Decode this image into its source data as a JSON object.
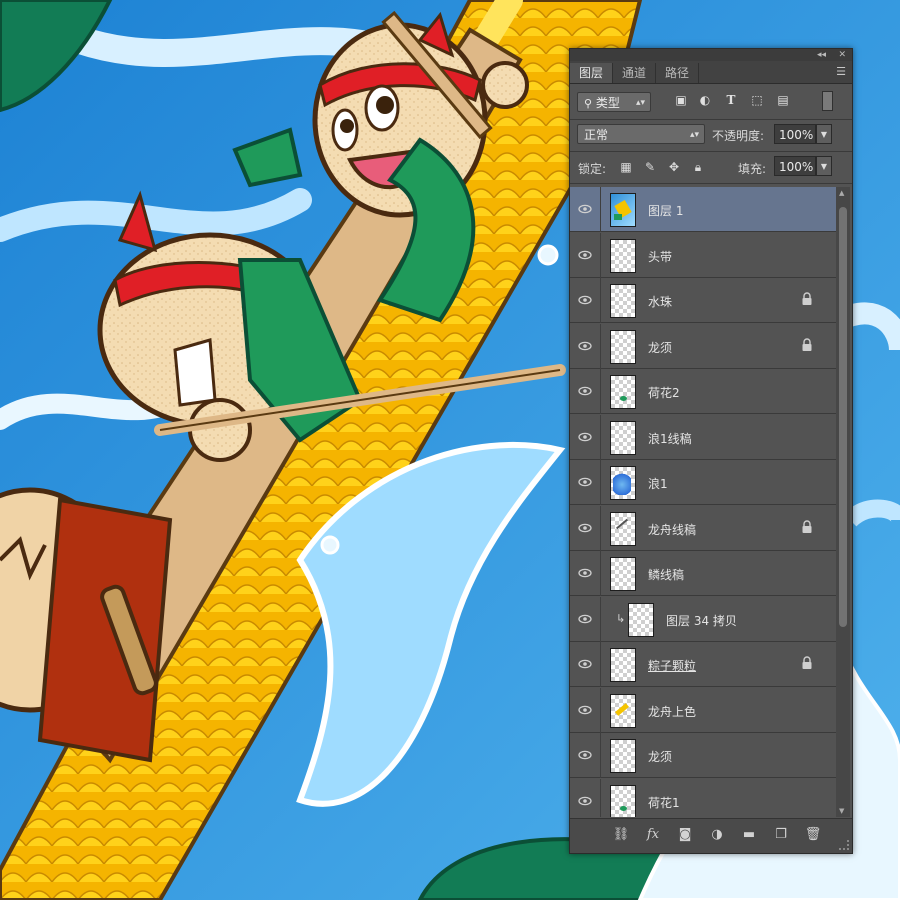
{
  "tabs": [
    "图层",
    "通道",
    "路径"
  ],
  "filter": {
    "kind_label": "类型",
    "icons": [
      "image-filter-icon",
      "adjustment-filter-icon",
      "type-filter-icon",
      "shape-filter-icon",
      "smart-object-filter-icon"
    ],
    "type_glyph": "T"
  },
  "blend": {
    "mode": "正常",
    "opacity_label": "不透明度:",
    "opacity_value": "100%"
  },
  "lock": {
    "label": "锁定:",
    "fill_label": "填充:",
    "fill_value": "100%"
  },
  "layers": [
    {
      "name": "图层 1",
      "selected": true,
      "locked": false,
      "thumb": "art"
    },
    {
      "name": "头带",
      "selected": false,
      "locked": false,
      "thumb": "empty"
    },
    {
      "name": "水珠",
      "selected": false,
      "locked": true,
      "thumb": "empty"
    },
    {
      "name": "龙须",
      "selected": false,
      "locked": true,
      "thumb": "empty"
    },
    {
      "name": "荷花2",
      "selected": false,
      "locked": false,
      "thumb": "green-dot"
    },
    {
      "name": "浪1线稿",
      "selected": false,
      "locked": false,
      "thumb": "empty"
    },
    {
      "name": "浪1",
      "selected": false,
      "locked": false,
      "thumb": "wave"
    },
    {
      "name": "龙舟线稿",
      "selected": false,
      "locked": true,
      "thumb": "lines"
    },
    {
      "name": "鳞线稿",
      "selected": false,
      "locked": false,
      "thumb": "empty"
    },
    {
      "name": "图层 34 拷贝",
      "selected": false,
      "locked": false,
      "thumb": "empty",
      "clipped": true
    },
    {
      "name": "粽子颗粒",
      "selected": false,
      "locked": true,
      "thumb": "empty",
      "underlined": true
    },
    {
      "name": "龙舟上色",
      "selected": false,
      "locked": false,
      "thumb": "yellow"
    },
    {
      "name": "龙须",
      "selected": false,
      "locked": false,
      "thumb": "empty"
    },
    {
      "name": "荷花1",
      "selected": false,
      "locked": false,
      "thumb": "green-dot"
    }
  ],
  "footer_icons": [
    "link-layers-icon",
    "fx-icon",
    "add-mask-icon",
    "adjustment-layer-icon",
    "new-group-icon",
    "new-layer-icon",
    "delete-layer-icon"
  ],
  "colors": {
    "panel_bg": "#535353",
    "selected_row": "#66758f",
    "sky": "#2f8fd8",
    "dragon_yellow": "#f5c400",
    "headband_red": "#e01f26",
    "scarf_green": "#1f9a5a"
  }
}
